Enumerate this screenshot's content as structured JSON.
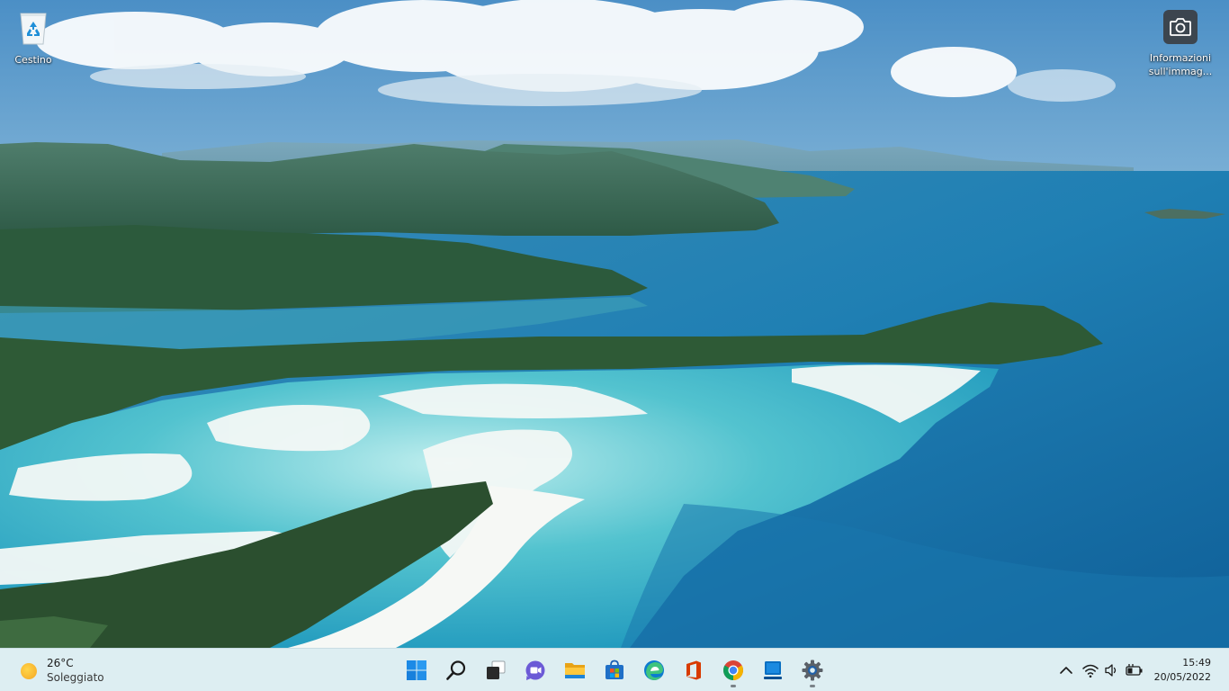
{
  "desktop": {
    "icons": [
      {
        "label": "Cestino",
        "icon": "recycle-bin-icon"
      },
      {
        "label": "Informazioni sull'immag...",
        "icon": "camera-icon"
      }
    ]
  },
  "taskbar": {
    "weather": {
      "temperature": "26°C",
      "condition": "Soleggiato",
      "icon": "sun-icon"
    },
    "apps": [
      {
        "name": "Start",
        "icon": "windows-start-icon",
        "running": false
      },
      {
        "name": "Cerca",
        "icon": "search-icon",
        "running": false
      },
      {
        "name": "Visualizzazione attività",
        "icon": "task-view-icon",
        "running": false
      },
      {
        "name": "Chat",
        "icon": "chat-icon",
        "running": false
      },
      {
        "name": "Esplora file",
        "icon": "file-explorer-icon",
        "running": false
      },
      {
        "name": "Microsoft Store",
        "icon": "store-icon",
        "running": false
      },
      {
        "name": "Microsoft Edge",
        "icon": "edge-icon",
        "running": false
      },
      {
        "name": "Office",
        "icon": "office-icon",
        "running": false
      },
      {
        "name": "Google Chrome",
        "icon": "chrome-icon",
        "running": true
      },
      {
        "name": "App",
        "icon": "blue-app-icon",
        "running": false
      },
      {
        "name": "Impostazioni",
        "icon": "settings-gear-icon",
        "running": true
      }
    ],
    "tray": {
      "icons": [
        "show-hidden-icons-chevron-icon",
        "wifi-icon",
        "volume-icon",
        "battery-charging-icon"
      ],
      "time": "15:49",
      "date": "20/05/2022"
    }
  },
  "colors": {
    "taskbar_bg": "#ddeef2",
    "sky": "#8ab8d8",
    "lagoon": "#39b6c6",
    "deep_sea": "#1a79b0",
    "forest": "#2e5a36",
    "sand": "#f2f6f4",
    "running_indicator": "#7a8288"
  }
}
